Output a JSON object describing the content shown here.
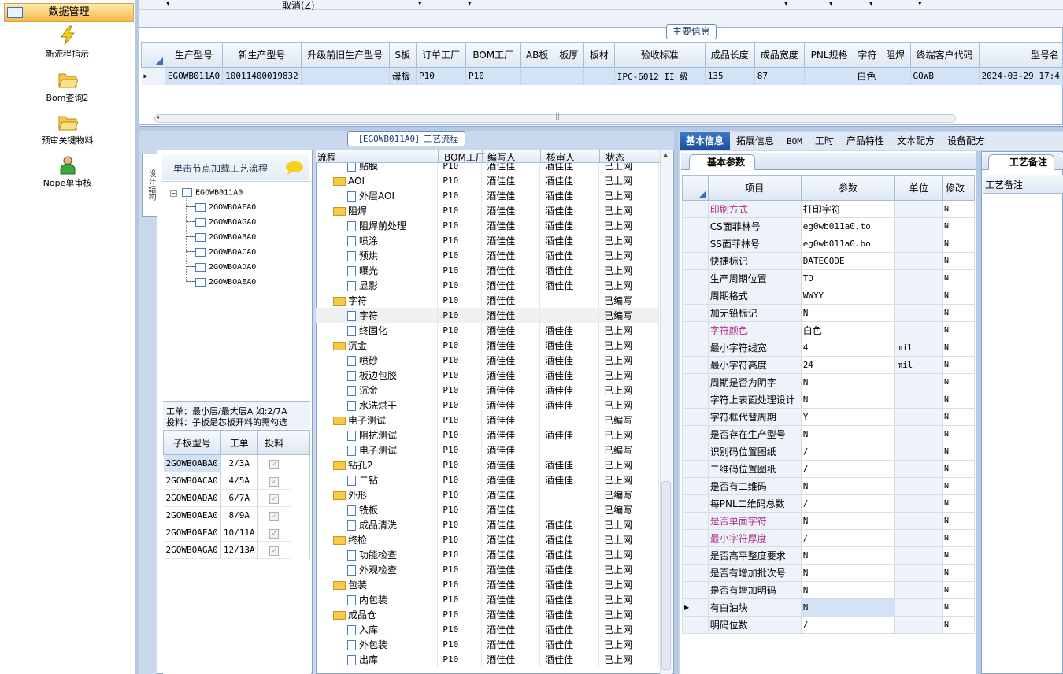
{
  "nav": {
    "header": "数据管理",
    "items": [
      {
        "label": "新流程指示",
        "icon": "lightning-icon"
      },
      {
        "label": "Bom查询2",
        "icon": "folder-open-icon"
      },
      {
        "label": "预审关键物料",
        "icon": "folder-open-icon"
      },
      {
        "label": "Nope单审核",
        "icon": "user-icon"
      }
    ]
  },
  "toolbar": {
    "cancel": "取消(Z)"
  },
  "main_info": {
    "title": "主要信息",
    "columns": [
      "生产型号",
      "新生产型号",
      "升级前旧生产型号",
      "S板",
      "订单工厂",
      "BOM工厂",
      "AB板",
      "板厚",
      "板材",
      "验收标准",
      "成品长度",
      "成品宽度",
      "PNL规格",
      "字符",
      "阻焊",
      "终端客户代码",
      "型号名"
    ],
    "row": [
      "EGOWB011A0",
      "10011400019832",
      "",
      "母板",
      "P10",
      "P10",
      "",
      "",
      "",
      "IPC-6012 II 级",
      "135",
      "87",
      "",
      "白色",
      "",
      "GOWB",
      "2024-03-29 17:4"
    ]
  },
  "struct": {
    "side_tab": "设计结构",
    "hint": "单击节点加载工艺流程",
    "root": "EGOWB011A0",
    "children": [
      "2GOWBOAFA0",
      "2GOWBOAGA0",
      "2GOWBOABA0",
      "2GOWBOACA0",
      "2GOWBOADA0",
      "2GOWBOAEA0"
    ],
    "note1": "工单：最小层/最大层A 如:2/7A",
    "note2": "投料：子板是芯板开料的需勾选",
    "sub_headers": [
      "子板型号",
      "工单",
      "投料"
    ],
    "sub_rows": [
      [
        "2GOWBOABA0",
        "2/3A"
      ],
      [
        "2GOWBOACA0",
        "4/5A"
      ],
      [
        "2GOWBOADA0",
        "6/7A"
      ],
      [
        "2GOWBOAEA0",
        "8/9A"
      ],
      [
        "2GOWBOAFA0",
        "10/11A"
      ],
      [
        "2GOWBOAGA0",
        "12/13A"
      ]
    ]
  },
  "process": {
    "title": "【EGOWB011A0】工艺流程",
    "headers": [
      "流程",
      "BOM工厂",
      "编写人",
      "核审人",
      "状态"
    ],
    "rows": [
      {
        "lvl": 2,
        "name": "贴膜",
        "f": "P10",
        "w": "酒佳佳",
        "r": "酒佳佳",
        "s": "已上网"
      },
      {
        "lvl": 1,
        "name": "AOI",
        "f": "P10",
        "w": "酒佳佳",
        "r": "酒佳佳",
        "s": "已上网"
      },
      {
        "lvl": 2,
        "name": "外层AOI",
        "f": "P10",
        "w": "酒佳佳",
        "r": "酒佳佳",
        "s": "已上网"
      },
      {
        "lvl": 1,
        "name": "阻焊",
        "f": "P10",
        "w": "酒佳佳",
        "r": "酒佳佳",
        "s": "已上网"
      },
      {
        "lvl": 2,
        "name": "阻焊前处理",
        "f": "P10",
        "w": "酒佳佳",
        "r": "酒佳佳",
        "s": "已上网"
      },
      {
        "lvl": 2,
        "name": "喷涂",
        "f": "P10",
        "w": "酒佳佳",
        "r": "酒佳佳",
        "s": "已上网"
      },
      {
        "lvl": 2,
        "name": "预烘",
        "f": "P10",
        "w": "酒佳佳",
        "r": "酒佳佳",
        "s": "已上网"
      },
      {
        "lvl": 2,
        "name": "曝光",
        "f": "P10",
        "w": "酒佳佳",
        "r": "酒佳佳",
        "s": "已上网"
      },
      {
        "lvl": 2,
        "name": "显影",
        "f": "P10",
        "w": "酒佳佳",
        "r": "酒佳佳",
        "s": "已上网"
      },
      {
        "lvl": 1,
        "name": "字符",
        "f": "P10",
        "w": "酒佳佳",
        "r": "",
        "s": "已编写"
      },
      {
        "lvl": 2,
        "name": "字符",
        "f": "P10",
        "w": "酒佳佳",
        "r": "",
        "s": "已编写"
      },
      {
        "lvl": 2,
        "name": "终固化",
        "f": "P10",
        "w": "酒佳佳",
        "r": "酒佳佳",
        "s": "已上网"
      },
      {
        "lvl": 1,
        "name": "沉金",
        "f": "P10",
        "w": "酒佳佳",
        "r": "酒佳佳",
        "s": "已上网"
      },
      {
        "lvl": 2,
        "name": "喷砂",
        "f": "P10",
        "w": "酒佳佳",
        "r": "酒佳佳",
        "s": "已上网"
      },
      {
        "lvl": 2,
        "name": "板边包胶",
        "f": "P10",
        "w": "酒佳佳",
        "r": "酒佳佳",
        "s": "已上网"
      },
      {
        "lvl": 2,
        "name": "沉金",
        "f": "P10",
        "w": "酒佳佳",
        "r": "酒佳佳",
        "s": "已上网"
      },
      {
        "lvl": 2,
        "name": "水洗烘干",
        "f": "P10",
        "w": "酒佳佳",
        "r": "酒佳佳",
        "s": "已上网"
      },
      {
        "lvl": 1,
        "name": "电子测试",
        "f": "P10",
        "w": "酒佳佳",
        "r": "",
        "s": "已编写"
      },
      {
        "lvl": 2,
        "name": "阻抗测试",
        "f": "P10",
        "w": "酒佳佳",
        "r": "酒佳佳",
        "s": "已上网"
      },
      {
        "lvl": 2,
        "name": "电子测试",
        "f": "P10",
        "w": "酒佳佳",
        "r": "",
        "s": "已编写"
      },
      {
        "lvl": 1,
        "name": "钻孔2",
        "f": "P10",
        "w": "酒佳佳",
        "r": "酒佳佳",
        "s": "已上网"
      },
      {
        "lvl": 2,
        "name": "二钻",
        "f": "P10",
        "w": "酒佳佳",
        "r": "酒佳佳",
        "s": "已上网"
      },
      {
        "lvl": 1,
        "name": "外形",
        "f": "P10",
        "w": "酒佳佳",
        "r": "",
        "s": "已编写"
      },
      {
        "lvl": 2,
        "name": "铣板",
        "f": "P10",
        "w": "酒佳佳",
        "r": "",
        "s": "已编写"
      },
      {
        "lvl": 2,
        "name": "成品清洗",
        "f": "P10",
        "w": "酒佳佳",
        "r": "酒佳佳",
        "s": "已上网"
      },
      {
        "lvl": 1,
        "name": "终检",
        "f": "P10",
        "w": "酒佳佳",
        "r": "酒佳佳",
        "s": "已上网"
      },
      {
        "lvl": 2,
        "name": "功能检查",
        "f": "P10",
        "w": "酒佳佳",
        "r": "酒佳佳",
        "s": "已上网"
      },
      {
        "lvl": 2,
        "name": "外观检查",
        "f": "P10",
        "w": "酒佳佳",
        "r": "酒佳佳",
        "s": "已上网"
      },
      {
        "lvl": 1,
        "name": "包装",
        "f": "P10",
        "w": "酒佳佳",
        "r": "酒佳佳",
        "s": "已上网"
      },
      {
        "lvl": 2,
        "name": "内包装",
        "f": "P10",
        "w": "酒佳佳",
        "r": "酒佳佳",
        "s": "已上网"
      },
      {
        "lvl": 1,
        "name": "成品仓",
        "f": "P10",
        "w": "酒佳佳",
        "r": "酒佳佳",
        "s": "已上网"
      },
      {
        "lvl": 2,
        "name": "入库",
        "f": "P10",
        "w": "酒佳佳",
        "r": "酒佳佳",
        "s": "已上网"
      },
      {
        "lvl": 2,
        "name": "外包装",
        "f": "P10",
        "w": "酒佳佳",
        "r": "酒佳佳",
        "s": "已上网"
      },
      {
        "lvl": 2,
        "name": "出库",
        "f": "P10",
        "w": "酒佳佳",
        "r": "酒佳佳",
        "s": "已上网"
      }
    ]
  },
  "tabs": [
    "基本信息",
    "拓展信息",
    "BOM",
    "工时",
    "产品特性",
    "文本配方",
    "设备配方"
  ],
  "basic": {
    "subtab": "基本参数",
    "headers": [
      "项目",
      "参数",
      "单位",
      "修改"
    ],
    "rows": [
      {
        "k": "印刷方式",
        "v": "打印字符",
        "u": "",
        "m": "N",
        "pink": true
      },
      {
        "k": "CS面菲林号",
        "v": "eg0wb011a0.to",
        "u": "",
        "m": "N"
      },
      {
        "k": "SS面菲林号",
        "v": "eg0wb011a0.bo",
        "u": "",
        "m": "N"
      },
      {
        "k": "快捷标记",
        "v": "DATECODE",
        "u": "",
        "m": "N"
      },
      {
        "k": "生产周期位置",
        "v": "TO",
        "u": "",
        "m": "N"
      },
      {
        "k": "周期格式",
        "v": "WWYY",
        "u": "",
        "m": "N"
      },
      {
        "k": "加无铅标记",
        "v": "N",
        "u": "",
        "m": "N"
      },
      {
        "k": "字符颜色",
        "v": "白色",
        "u": "",
        "m": "N",
        "pink": true
      },
      {
        "k": "最小字符线宽",
        "v": "4",
        "u": "mil",
        "m": "N"
      },
      {
        "k": "最小字符高度",
        "v": "24",
        "u": "mil",
        "m": "N"
      },
      {
        "k": "周期是否为阴字",
        "v": "N",
        "u": "",
        "m": "N"
      },
      {
        "k": "字符上表面处理设计",
        "v": "N",
        "u": "",
        "m": "N"
      },
      {
        "k": "字符框代替周期",
        "v": "Y",
        "u": "",
        "m": "N"
      },
      {
        "k": "是否存在生产型号",
        "v": "N",
        "u": "",
        "m": "N"
      },
      {
        "k": "识别码位置图纸",
        "v": "/",
        "u": "",
        "m": "N"
      },
      {
        "k": "二维码位置图纸",
        "v": "/",
        "u": "",
        "m": "N"
      },
      {
        "k": "是否有二维码",
        "v": "N",
        "u": "",
        "m": "N"
      },
      {
        "k": "每PNL二维码总数",
        "v": "/",
        "u": "",
        "m": "N"
      },
      {
        "k": "是否单面字符",
        "v": "N",
        "u": "",
        "m": "N",
        "pink": true
      },
      {
        "k": "最小字符厚度",
        "v": "/",
        "u": "",
        "m": "N",
        "pink": true
      },
      {
        "k": "是否高平整度要求",
        "v": "N",
        "u": "",
        "m": "N"
      },
      {
        "k": "是否有增加批次号",
        "v": "N",
        "u": "",
        "m": "N"
      },
      {
        "k": "是否有增加明码",
        "v": "N",
        "u": "",
        "m": "N"
      },
      {
        "k": "有白油块",
        "v": "N",
        "u": "",
        "m": "N"
      },
      {
        "k": "明码位数",
        "v": "/",
        "u": "",
        "m": "N"
      }
    ]
  },
  "notes": {
    "tab": "工艺备注",
    "header": "工艺备注"
  }
}
